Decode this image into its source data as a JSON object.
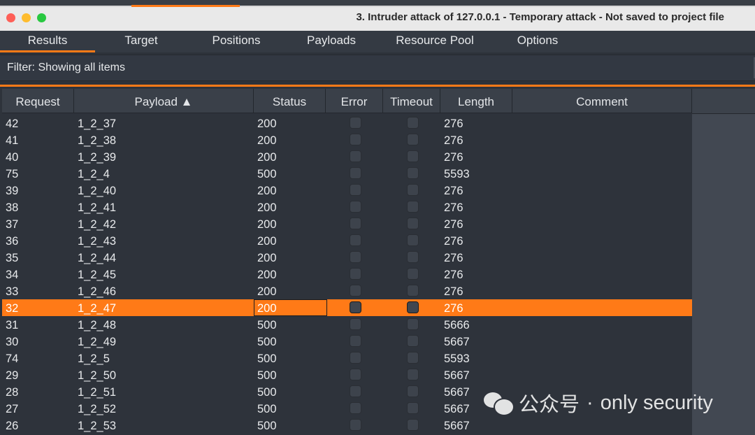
{
  "window": {
    "title": "3. Intruder attack of 127.0.0.1 - Temporary attack - Not saved to project file"
  },
  "tabs": [
    {
      "label": "Results",
      "active": true
    },
    {
      "label": "Target",
      "active": false
    },
    {
      "label": "Positions",
      "active": false
    },
    {
      "label": "Payloads",
      "active": false
    },
    {
      "label": "Resource Pool",
      "active": false
    },
    {
      "label": "Options",
      "active": false
    }
  ],
  "filter": {
    "text": "Filter: Showing all items"
  },
  "table": {
    "columns": [
      "Request",
      "Payload ▲",
      "Status",
      "Error",
      "Timeout",
      "Length",
      "Comment"
    ],
    "rows": [
      {
        "request": "42",
        "payload": "1_2_37",
        "status": "200",
        "length": "276"
      },
      {
        "request": "41",
        "payload": "1_2_38",
        "status": "200",
        "length": "276"
      },
      {
        "request": "40",
        "payload": "1_2_39",
        "status": "200",
        "length": "276"
      },
      {
        "request": "75",
        "payload": "1_2_4",
        "status": "500",
        "length": "5593"
      },
      {
        "request": "39",
        "payload": "1_2_40",
        "status": "200",
        "length": "276"
      },
      {
        "request": "38",
        "payload": "1_2_41",
        "status": "200",
        "length": "276"
      },
      {
        "request": "37",
        "payload": "1_2_42",
        "status": "200",
        "length": "276"
      },
      {
        "request": "36",
        "payload": "1_2_43",
        "status": "200",
        "length": "276"
      },
      {
        "request": "35",
        "payload": "1_2_44",
        "status": "200",
        "length": "276"
      },
      {
        "request": "34",
        "payload": "1_2_45",
        "status": "200",
        "length": "276"
      },
      {
        "request": "33",
        "payload": "1_2_46",
        "status": "200",
        "length": "276"
      },
      {
        "request": "32",
        "payload": "1_2_47",
        "status": "200",
        "length": "276",
        "selected": true
      },
      {
        "request": "31",
        "payload": "1_2_48",
        "status": "500",
        "length": "5666"
      },
      {
        "request": "30",
        "payload": "1_2_49",
        "status": "500",
        "length": "5667"
      },
      {
        "request": "74",
        "payload": "1_2_5",
        "status": "500",
        "length": "5593"
      },
      {
        "request": "29",
        "payload": "1_2_50",
        "status": "500",
        "length": "5667"
      },
      {
        "request": "28",
        "payload": "1_2_51",
        "status": "500",
        "length": "5667"
      },
      {
        "request": "27",
        "payload": "1_2_52",
        "status": "500",
        "length": "5667"
      },
      {
        "request": "26",
        "payload": "1_2_53",
        "status": "500",
        "length": "5667"
      }
    ]
  },
  "watermark": {
    "brand": "公众号",
    "separator": "·",
    "name": "only security"
  },
  "colors": {
    "accent": "#ff7a17",
    "background": "#2d323a",
    "header": "#3a4049"
  }
}
